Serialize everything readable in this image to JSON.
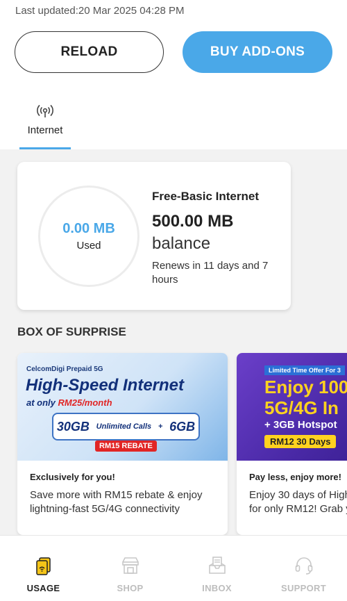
{
  "header": {
    "last_updated": "Last updated:20 Mar 2025 04:28 PM"
  },
  "actions": {
    "reload_label": "RELOAD",
    "buy_addons_label": "BUY ADD-ONS"
  },
  "tabs": [
    {
      "label": "Internet",
      "icon": "antenna-icon",
      "active": true
    }
  ],
  "usage": {
    "used_value": "0.00 MB",
    "used_label": "Used",
    "plan_name": "Free-Basic Internet",
    "balance_amount": "500.00 MB",
    "balance_label": "balance",
    "renews": "Renews in 11 days and 7 hours"
  },
  "section": {
    "title": "BOX OF SURPRISE"
  },
  "promos": [
    {
      "banner": {
        "brand": "CelcomDigi Prepaid 5G",
        "headline": "High-Speed Internet",
        "price_prefix": "at only ",
        "price": "RM25/month",
        "data1": "30GB",
        "calls": "Unlimited Calls",
        "plus": "+",
        "data2": "6GB",
        "rebate": "RM15 REBATE"
      },
      "title": "Exclusively for you!",
      "description": "Save more with RM15 rebate & enjoy lightning-fast 5G/4G connectivity"
    },
    {
      "banner": {
        "tag": "Limited Time Offer For 3",
        "line1": "Enjoy 100",
        "line2": "5G/4G In",
        "line3": "+ 3GB Hotspot",
        "price": "RM12 30 Days"
      },
      "title": "Pay less, enjoy more!",
      "description": "Enjoy 30 days of High for only RM12! Grab y"
    }
  ],
  "bottom_nav": [
    {
      "label": "USAGE",
      "icon": "sim-card-icon",
      "active": true
    },
    {
      "label": "SHOP",
      "icon": "shop-icon",
      "active": false
    },
    {
      "label": "INBOX",
      "icon": "inbox-icon",
      "active": false
    },
    {
      "label": "SUPPORT",
      "icon": "headset-icon",
      "active": false
    }
  ],
  "colors": {
    "accent": "#4aa8e8",
    "active_nav": "#f5c518",
    "inactive": "#bdbdbd"
  }
}
